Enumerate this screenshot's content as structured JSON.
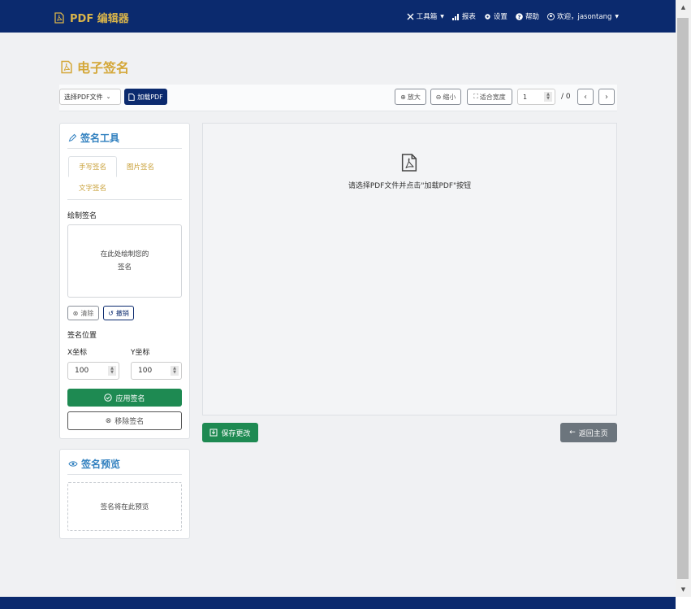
{
  "brand": {
    "name": "PDF 编辑器"
  },
  "nav": {
    "tools": "工具箱",
    "report": "报表",
    "settings": "设置",
    "help": "帮助",
    "user": "欢迎，jasontang"
  },
  "page": {
    "title": "电子签名"
  },
  "toolbar": {
    "select_label": "选择PDF文件",
    "load_label": "加载PDF",
    "zoom_in": "放大",
    "zoom_out": "缩小",
    "fit_width": "适合宽度",
    "page_value": "1",
    "page_total": "/ 0"
  },
  "sign_tools": {
    "title": "签名工具",
    "tabs": [
      "手写签名",
      "图片签名",
      "文字签名"
    ],
    "draw_label": "绘制签名",
    "canvas_hint_line1": "在此处绘制您的",
    "canvas_hint_line2": "签名",
    "clear_label": "清除",
    "undo_label": "撤销",
    "position_label": "签名位置",
    "x_label": "X坐标",
    "y_label": "Y坐标",
    "x_value": "100",
    "y_value": "100",
    "apply_label": "应用签名",
    "remove_label": "移除签名"
  },
  "preview": {
    "title": "签名预览",
    "placeholder": "签名将在此预览"
  },
  "viewer": {
    "message": "请选择PDF文件并点击\"加载PDF\"按钮"
  },
  "actions": {
    "save_label": "保存更改",
    "back_label": "返回主页"
  },
  "colors": {
    "navbar": "#0b2a6e",
    "brand_gold": "#d4a738",
    "accent_blue": "#2f7fbf",
    "success_green": "#1e8a52",
    "secondary_gray": "#6c757d"
  }
}
